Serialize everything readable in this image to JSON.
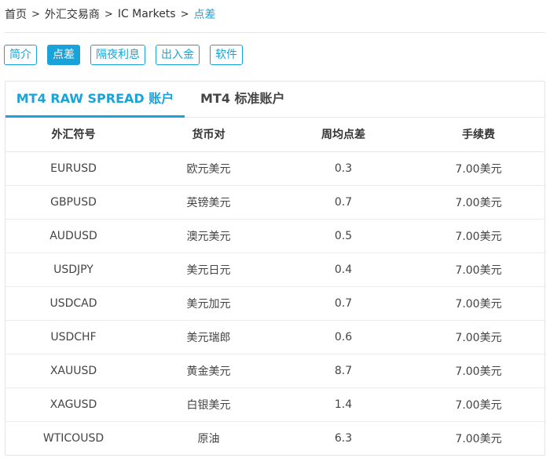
{
  "breadcrumb": {
    "items": [
      "首页",
      "外汇交易商",
      "IC Markets",
      "点差"
    ],
    "separator": ">"
  },
  "subnav": {
    "items": [
      "简介",
      "点差",
      "隔夜利息",
      "出入金",
      "软件"
    ],
    "active": "点差"
  },
  "tabs": {
    "items": [
      "MT4 RAW SPREAD 账户",
      "MT4 标准账户"
    ],
    "active": "MT4 RAW SPREAD 账户"
  },
  "table": {
    "headers": [
      "外汇符号",
      "货币对",
      "周均点差",
      "手续费"
    ],
    "rows": [
      [
        "EURUSD",
        "欧元美元",
        "0.3",
        "7.00美元"
      ],
      [
        "GBPUSD",
        "英镑美元",
        "0.7",
        "7.00美元"
      ],
      [
        "AUDUSD",
        "澳元美元",
        "0.5",
        "7.00美元"
      ],
      [
        "USDJPY",
        "美元日元",
        "0.4",
        "7.00美元"
      ],
      [
        "USDCAD",
        "美元加元",
        "0.7",
        "7.00美元"
      ],
      [
        "USDCHF",
        "美元瑞郎",
        "0.6",
        "7.00美元"
      ],
      [
        "XAUUSD",
        "黄金美元",
        "8.7",
        "7.00美元"
      ],
      [
        "XAGUSD",
        "白银美元",
        "1.4",
        "7.00美元"
      ],
      [
        "WTICOUSD",
        "原油",
        "6.3",
        "7.00美元"
      ]
    ]
  },
  "colors": {
    "accent": "#1aa3d9",
    "text": "#333333",
    "border": "#e8e8e8"
  }
}
